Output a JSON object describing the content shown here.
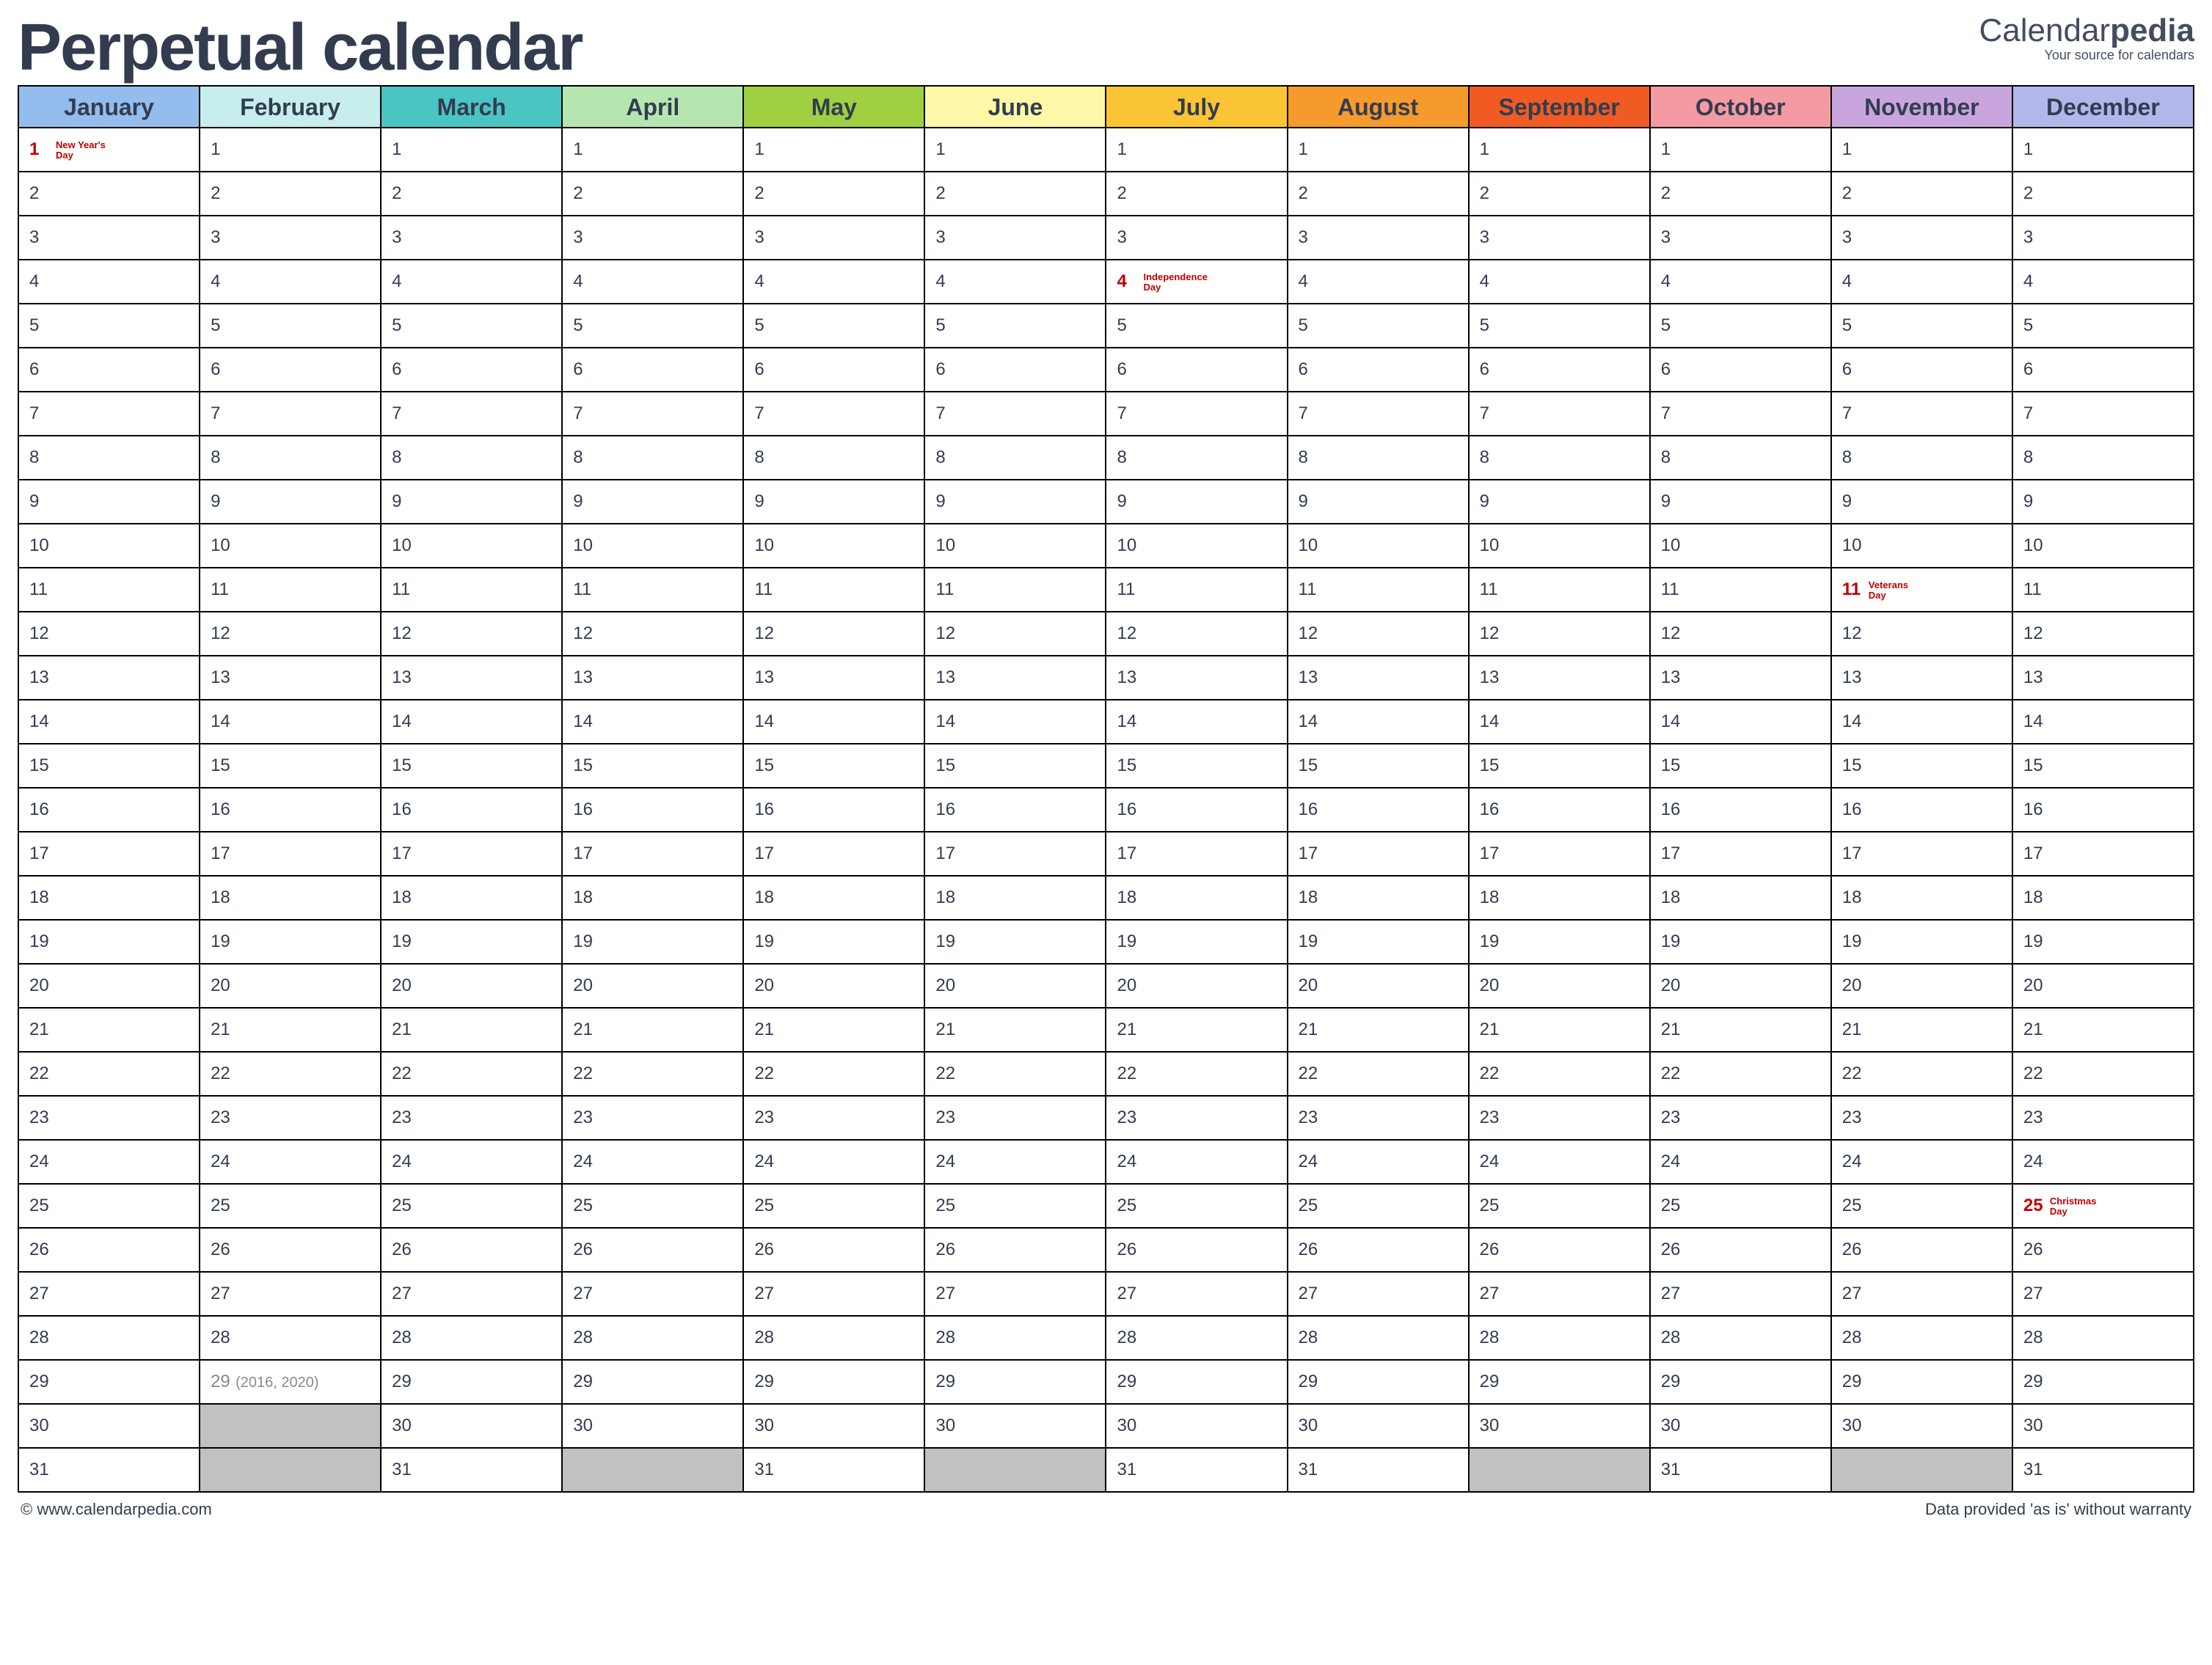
{
  "header": {
    "title": "Perpetual calendar",
    "brand_prefix": "Calendar",
    "brand_suffix": "pedia",
    "brand_tagline": "Your source for calendars"
  },
  "months": [
    {
      "name": "January",
      "color": "#93bdec"
    },
    {
      "name": "February",
      "color": "#c5eeed"
    },
    {
      "name": "March",
      "color": "#4bc4c4"
    },
    {
      "name": "April",
      "color": "#b6e6b0"
    },
    {
      "name": "May",
      "color": "#9ed042"
    },
    {
      "name": "June",
      "color": "#fcf8a8"
    },
    {
      "name": "July",
      "color": "#fbc435"
    },
    {
      "name": "August",
      "color": "#f59a2c"
    },
    {
      "name": "September",
      "color": "#f05b23"
    },
    {
      "name": "October",
      "color": "#f39aa2"
    },
    {
      "name": "November",
      "color": "#c9a5de"
    },
    {
      "name": "December",
      "color": "#b3b6ea"
    }
  ],
  "max_days": 31,
  "month_lengths": [
    31,
    29,
    31,
    30,
    31,
    30,
    31,
    31,
    30,
    31,
    30,
    31
  ],
  "leap_cell": {
    "month_index": 1,
    "day": 29,
    "note": "(2016, 2020)"
  },
  "holidays": [
    {
      "month_index": 0,
      "day": 1,
      "label": "New Year's Day"
    },
    {
      "month_index": 6,
      "day": 4,
      "label": "Independence Day"
    },
    {
      "month_index": 10,
      "day": 11,
      "label": "Veterans Day"
    },
    {
      "month_index": 11,
      "day": 25,
      "label": "Christmas Day"
    }
  ],
  "footer": {
    "left": "© www.calendarpedia.com",
    "right": "Data provided 'as is' without warranty"
  }
}
